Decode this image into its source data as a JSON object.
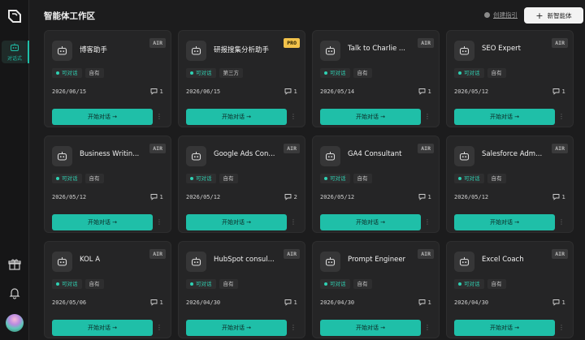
{
  "rail": {
    "nav_label": "对话式"
  },
  "header": {
    "title": "智能体工作区",
    "guide_label": "创建指引",
    "new_agent_label": "新智能体"
  },
  "card_common": {
    "status_label": "可对话",
    "start_label": "开始对话 →",
    "more_label": "⋮"
  },
  "agents": [
    {
      "name": "博客助手",
      "badge": "AIR",
      "tag": "自有",
      "date": "2026/06/15",
      "count": "1"
    },
    {
      "name": "研报搜集分析助手",
      "badge": "PRO",
      "tag": "第三方",
      "date": "2026/06/15",
      "count": "1"
    },
    {
      "name": "Talk to Charlie ...",
      "badge": "AIR",
      "tag": "自有",
      "date": "2026/05/14",
      "count": "1"
    },
    {
      "name": "SEO Expert",
      "badge": "AIR",
      "tag": "自有",
      "date": "2026/05/12",
      "count": "1"
    },
    {
      "name": "Business Writin...",
      "badge": "AIR",
      "tag": "自有",
      "date": "2026/05/12",
      "count": "1"
    },
    {
      "name": "Google Ads Con...",
      "badge": "AIR",
      "tag": "自有",
      "date": "2026/05/12",
      "count": "2"
    },
    {
      "name": "GA4 Consultant",
      "badge": "AIR",
      "tag": "自有",
      "date": "2026/05/12",
      "count": "1"
    },
    {
      "name": "Salesforce Adm...",
      "badge": "AIR",
      "tag": "自有",
      "date": "2026/05/12",
      "count": "1"
    },
    {
      "name": "KOL A",
      "badge": "AIR",
      "tag": "自有",
      "date": "2026/05/06",
      "count": "1"
    },
    {
      "name": "HubSpot consul...",
      "badge": "AIR",
      "tag": "自有",
      "date": "2026/04/30",
      "count": "1"
    },
    {
      "name": "Prompt Engineer",
      "badge": "AIR",
      "tag": "自有",
      "date": "2026/04/30",
      "count": "1"
    },
    {
      "name": "Excel Coach",
      "badge": "AIR",
      "tag": "自有",
      "date": "2026/04/30",
      "count": "1"
    }
  ],
  "colors": {
    "accent": "#1fbfa8",
    "pro_badge": "#f2c24a",
    "card_bg": "#252526",
    "page_bg": "#1c1c1d"
  }
}
